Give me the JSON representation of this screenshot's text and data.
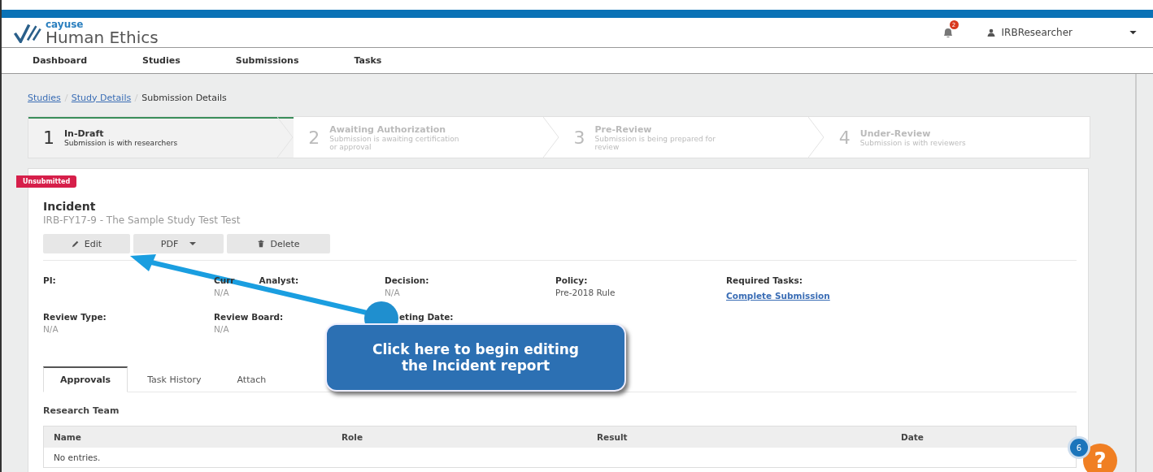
{
  "brand": {
    "company": "cayuse",
    "product": "Human Ethics"
  },
  "notifications": {
    "count": "2"
  },
  "user": {
    "name": "IRBResearcher"
  },
  "nav": [
    {
      "label": "Dashboard"
    },
    {
      "label": "Studies"
    },
    {
      "label": "Submissions"
    },
    {
      "label": "Tasks"
    }
  ],
  "breadcrumb": [
    {
      "label": "Studies",
      "kind": "link"
    },
    {
      "label": "Study Details",
      "kind": "link"
    },
    {
      "label": "Submission Details",
      "kind": "current"
    }
  ],
  "steps": [
    {
      "number": "1",
      "title": "In-Draft",
      "description": "Submission is with researchers",
      "selected": true
    },
    {
      "number": "2",
      "title": "Awaiting Authorization",
      "description": "Submission is awaiting certification or approval",
      "selected": false
    },
    {
      "number": "3",
      "title": "Pre-Review",
      "description": "Submission is being prepared for review",
      "selected": false
    },
    {
      "number": "4",
      "title": "Under-Review",
      "description": "Submission is with reviewers",
      "selected": false
    }
  ],
  "status": "Unsubmitted",
  "title": "Incident",
  "subtitle": "IRB-FY17-9 - The Sample Study Test Test",
  "actions": [
    {
      "label": "Edit",
      "kind": "edit"
    },
    {
      "label": "PDF",
      "kind": "dropdown"
    },
    {
      "label": "Delete",
      "kind": "delete"
    }
  ],
  "fields": [
    {
      "label": "PI:"
    },
    {
      "label": "Curr",
      "label_tail": "Analyst:",
      "value": "N/A"
    },
    {
      "label": "Decision:",
      "value": "N/A"
    },
    {
      "label": "Policy:",
      "value": "Pre-2018 Rule"
    },
    {
      "label": "Required Tasks:",
      "value": "Complete Submission",
      "kind": "link"
    },
    {
      "label": "Review Type:",
      "value": "N/A"
    },
    {
      "label": "Review Board:",
      "value": "N/A"
    },
    {
      "label": "eting Date:"
    }
  ],
  "tabs": [
    {
      "label": "Approvals",
      "selected": true
    },
    {
      "label": "Task History",
      "selected": false
    },
    {
      "label": "Attach",
      "selected": false
    }
  ],
  "section": "Research Team",
  "table": {
    "columns": [
      "Name",
      "Role",
      "Result",
      "Date"
    ],
    "empty": "No entries."
  },
  "callout": {
    "lines": [
      "Click here to begin editing",
      "the Incident report"
    ]
  },
  "help": {
    "count": "6",
    "symbol": "?"
  }
}
